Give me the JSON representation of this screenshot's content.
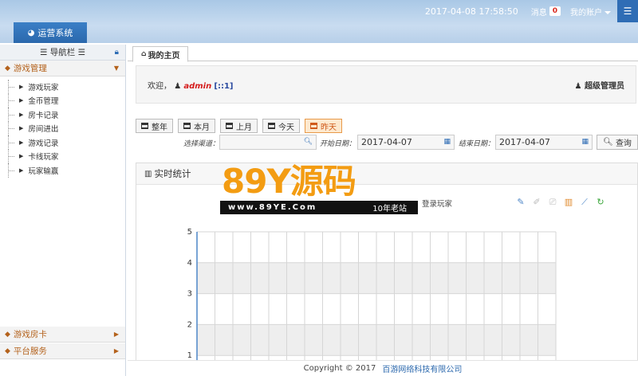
{
  "header": {
    "datetime": "2017-04-08 17:58:50",
    "messages_label": "消息",
    "messages_count": "0",
    "account_label": "我的账户",
    "module_tab": "运营系统"
  },
  "sidebar": {
    "title": "导航栏",
    "group_game": "游戏管理",
    "items": [
      "游戏玩家",
      "金币管理",
      "房卡记录",
      "房间进出",
      "游戏记录",
      "卡线玩家",
      "玩家输赢"
    ],
    "group_card": "游戏房卡",
    "group_platform": "平台服务"
  },
  "main": {
    "home_tab": "我的主页",
    "welcome_prefix": "欢迎，",
    "username": "admin",
    "ip": "[::1]",
    "role": "超级管理员",
    "quick_buttons": [
      "整年",
      "本月",
      "上月",
      "今天",
      "昨天"
    ],
    "channel_label": "选择渠道：",
    "start_label": "开始日期：",
    "start_date": "2017-04-07",
    "end_label": "结束日期：",
    "end_date": "2017-04-07",
    "search_label": "查询",
    "panel_title": "实时统计",
    "legend_series": "登录玩家"
  },
  "watermark": {
    "brand_num": "89Y",
    "brand_text": "源码",
    "site": "www.89YE.Com",
    "slogan": "10年老站"
  },
  "footer": {
    "copyright": "Copyright © 2017",
    "company": "百游网络科技有限公司"
  },
  "colors": {
    "accent": "#2f6db5",
    "nav_group": "#b4621c",
    "active_btn": "#d05a1a"
  },
  "chart_data": {
    "type": "line",
    "series": [],
    "ylim": [
      0,
      5
    ],
    "yticks": [
      1,
      2,
      3,
      4,
      5
    ],
    "grid": true,
    "legend_placement": "top"
  }
}
